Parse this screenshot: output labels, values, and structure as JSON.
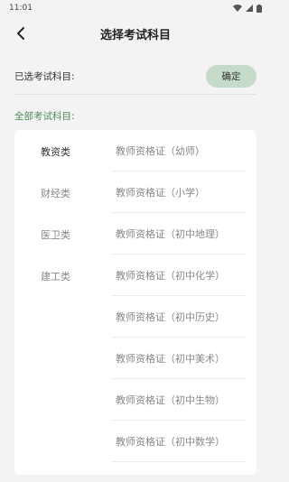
{
  "status_bar": {
    "time": "11:01"
  },
  "nav": {
    "title": "选择考试科目"
  },
  "selected": {
    "label": "已选考试科目:",
    "confirm_label": "确定"
  },
  "all_label": "全部考试科目:",
  "colors": {
    "accent_green": "#4b8b59",
    "confirm_bg": "#c5dbc9",
    "background": "#f3f3f3"
  },
  "categories": [
    {
      "label": "教资类",
      "active": true
    },
    {
      "label": "财经类",
      "active": false
    },
    {
      "label": "医卫类",
      "active": false
    },
    {
      "label": "建工类",
      "active": false
    }
  ],
  "subjects": [
    {
      "label": "教师资格证（幼师）"
    },
    {
      "label": "教师资格证（小学）"
    },
    {
      "label": "教师资格证（初中地理）"
    },
    {
      "label": "教师资格证（初中化学）"
    },
    {
      "label": "教师资格证（初中历史）"
    },
    {
      "label": "教师资格证（初中美术）"
    },
    {
      "label": "教师资格证（初中生物）"
    },
    {
      "label": "教师资格证（初中数学）"
    }
  ]
}
